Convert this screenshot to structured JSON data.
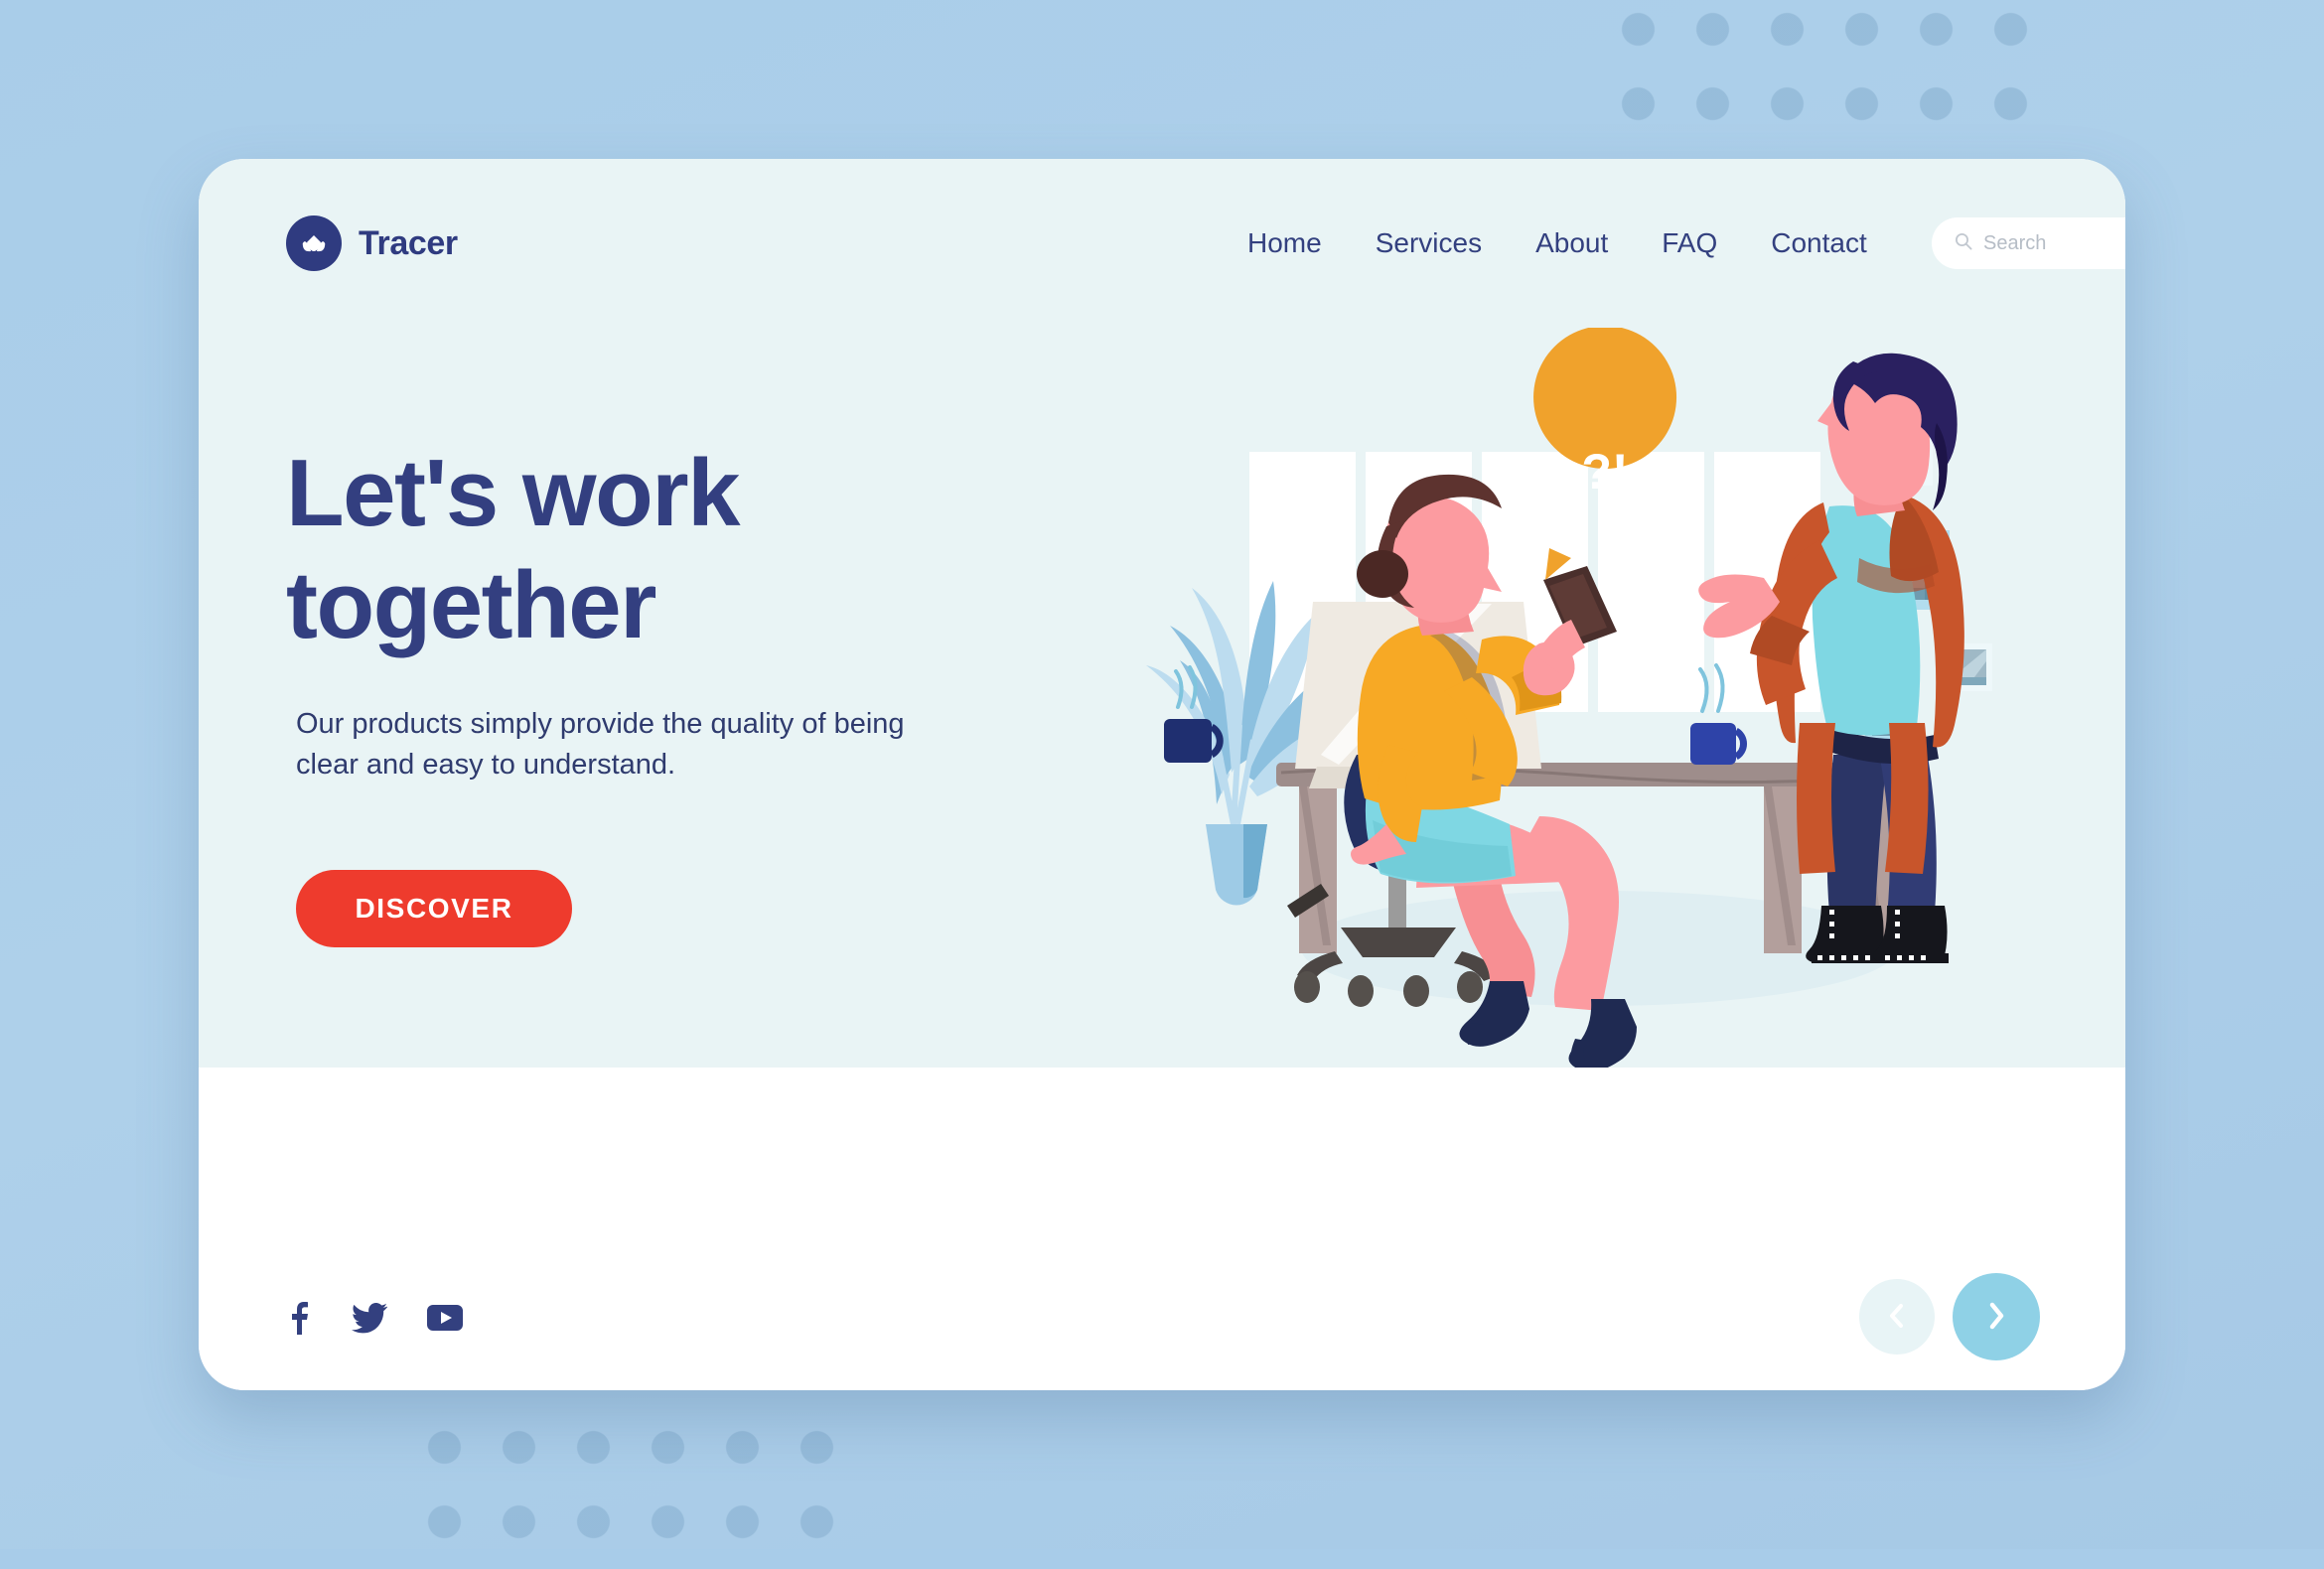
{
  "brand": {
    "name": "Tracer",
    "logo_icon": "lotus-mark-icon",
    "logo_bg": "#2f3b80"
  },
  "nav": {
    "items": [
      {
        "label": "Home"
      },
      {
        "label": "Services"
      },
      {
        "label": "About"
      },
      {
        "label": "FAQ"
      },
      {
        "label": "Contact"
      }
    ]
  },
  "search": {
    "icon": "search-icon",
    "placeholder": "Search",
    "value": ""
  },
  "hero": {
    "headline_line1": "Let's work",
    "headline_line2": "together",
    "subhead": "Our products simply provide the quality of being clear and easy to understand.",
    "cta_label": "DISCOVER",
    "cta_color": "#ee3b2d",
    "heading_color": "#333f80",
    "panel_color": "#e9f4f5"
  },
  "social": {
    "items": [
      {
        "name": "facebook-icon"
      },
      {
        "name": "twitter-icon"
      },
      {
        "name": "youtube-icon"
      }
    ]
  },
  "carousel": {
    "prev_icon": "chevron-left-icon",
    "next_icon": "chevron-right-icon",
    "prev_color": "#e8f4f6",
    "next_color": "#8fd1e6"
  },
  "illustration": {
    "alt": "Two coworkers talking at an office desk",
    "speech_bubble_text": "?!",
    "speech_bubble_color": "#f0a22c",
    "elements": [
      "office-window",
      "wall-frames",
      "potted-plant",
      "desk",
      "monitor",
      "coffee-mug-left",
      "coffee-mug-right",
      "seated-woman",
      "office-chair",
      "standing-man",
      "floor-shadow"
    ]
  },
  "page": {
    "background_color": "#a9cde9",
    "card_color": "#ffffff"
  }
}
